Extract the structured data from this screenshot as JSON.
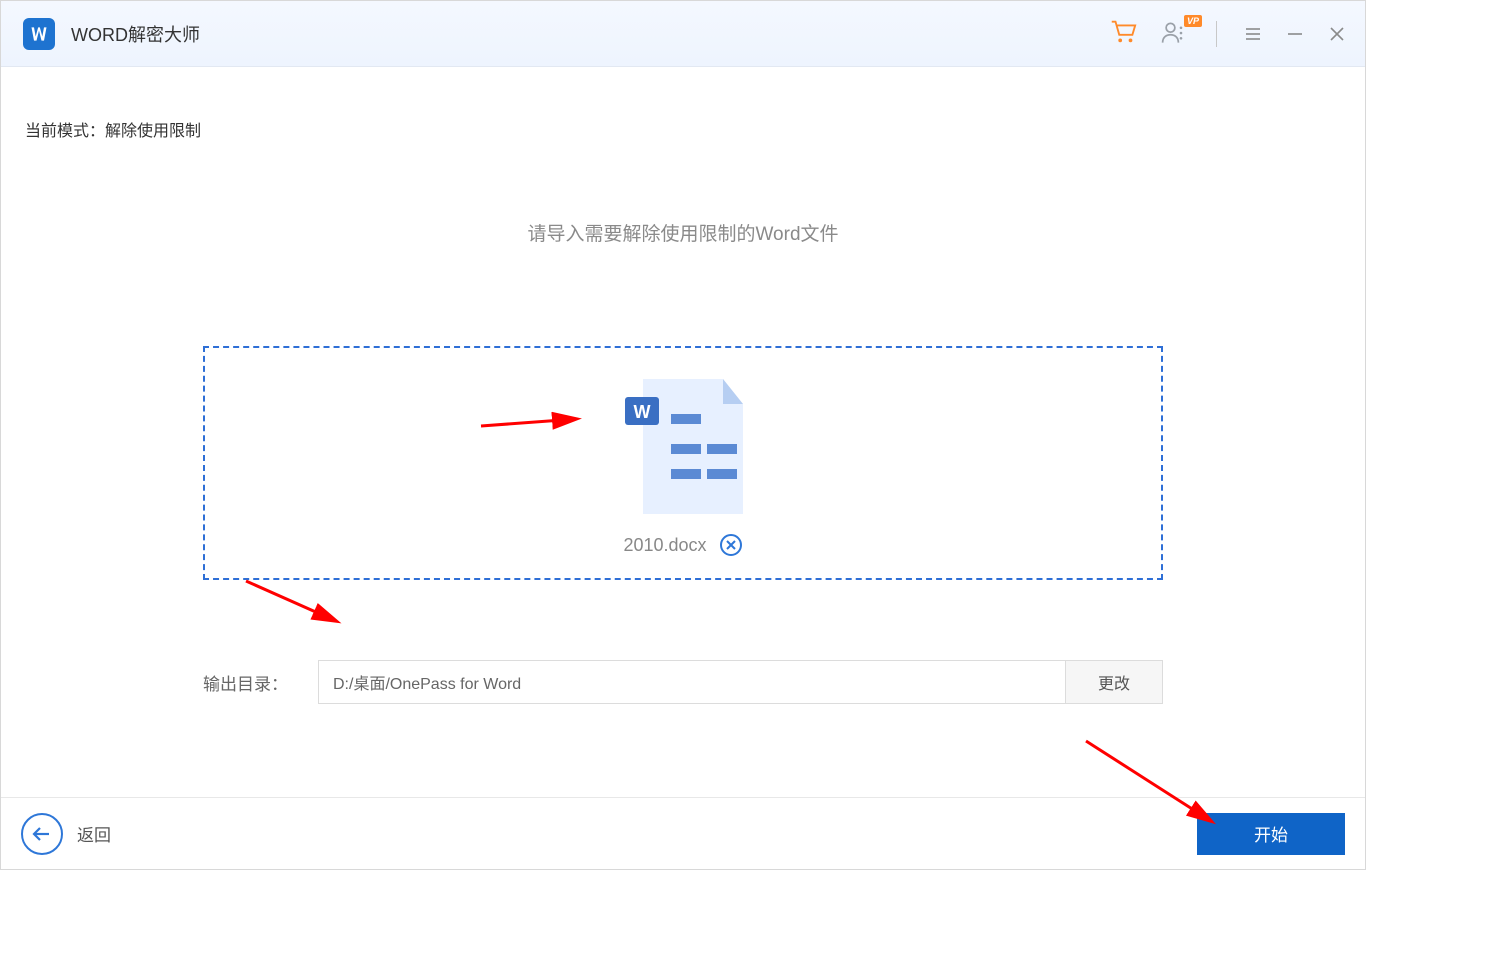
{
  "titlebar": {
    "app_title": "WORD解密大师",
    "vip_badge": "VP"
  },
  "mode": {
    "label": "当前模式：解除使用限制"
  },
  "prompt": "请导入需要解除使用限制的Word文件",
  "file": {
    "name": "2010.docx"
  },
  "output": {
    "label": "输出目录：",
    "value": "D:/桌面/OnePass for Word",
    "change_label": "更改"
  },
  "footer": {
    "back_label": "返回",
    "start_label": "开始"
  }
}
